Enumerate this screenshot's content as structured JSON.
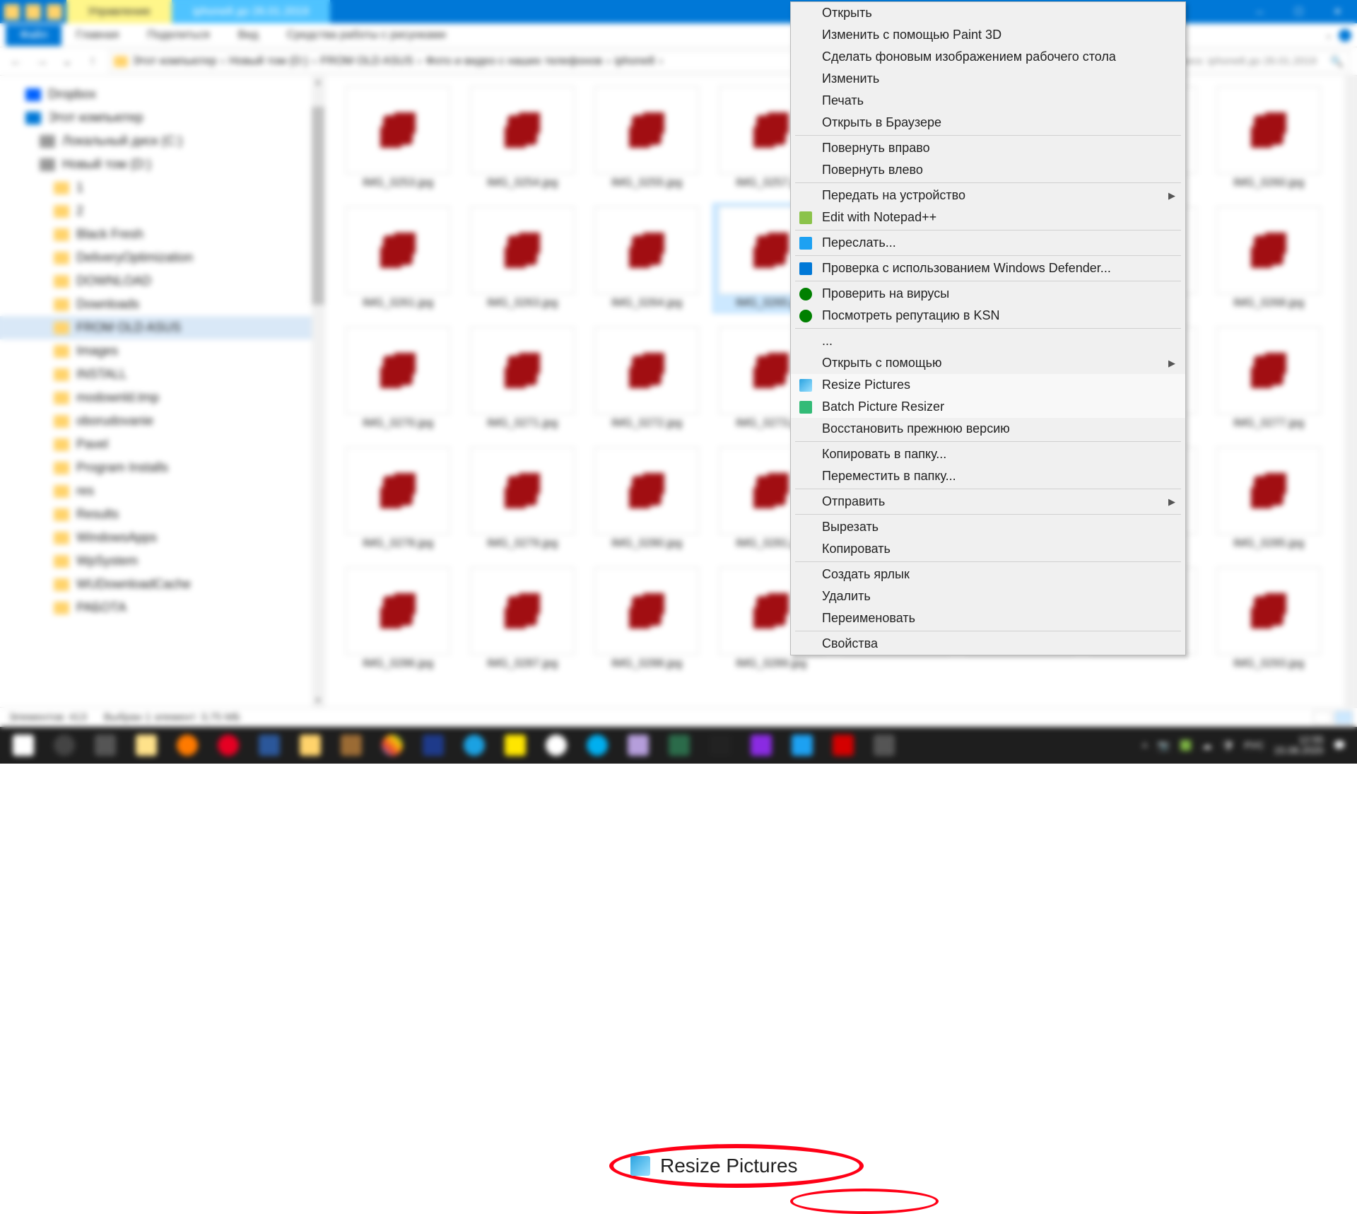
{
  "title_bar": {
    "tab_manage": "Управление",
    "tab_folder": "iphone8 до 26.01.2019"
  },
  "ribbon": {
    "file": "Файл",
    "home": "Главная",
    "share": "Поделиться",
    "view": "Вид",
    "pic_tools": "Средства работы с рисунками"
  },
  "breadcrumb": {
    "b1": "Этот компьютер",
    "b2": "Новый том (D:)",
    "b3": "FROM OLD ASUS",
    "b4": "Фото и видео с наших телефонов",
    "b5": "iphone8",
    "search_placeholder": "Поиск: iphone8 до 26.01.2019"
  },
  "sidebar": {
    "items": [
      {
        "label": "Dropbox",
        "icon": "dropbox",
        "indent": 0
      },
      {
        "label": "Этот компьютер",
        "icon": "pc",
        "indent": 0
      },
      {
        "label": "Локальный диск (C:)",
        "icon": "drive",
        "indent": 1
      },
      {
        "label": "Новый том (D:)",
        "icon": "drive",
        "indent": 1
      },
      {
        "label": "1",
        "icon": "",
        "indent": 2
      },
      {
        "label": "2",
        "icon": "",
        "indent": 2
      },
      {
        "label": "Black Fresh",
        "icon": "",
        "indent": 2
      },
      {
        "label": "DeliveryOptimization",
        "icon": "",
        "indent": 2
      },
      {
        "label": "DOWNLOAD",
        "icon": "",
        "indent": 2
      },
      {
        "label": "Downloads",
        "icon": "",
        "indent": 2
      },
      {
        "label": "FROM OLD ASUS",
        "icon": "",
        "indent": 2,
        "selected": true
      },
      {
        "label": "Images",
        "icon": "",
        "indent": 2
      },
      {
        "label": "INSTALL",
        "icon": "",
        "indent": 2
      },
      {
        "label": "modownld.tmp",
        "icon": "",
        "indent": 2
      },
      {
        "label": "oborudovanie",
        "icon": "",
        "indent": 2
      },
      {
        "label": "Pavel",
        "icon": "",
        "indent": 2
      },
      {
        "label": "Program Installs",
        "icon": "",
        "indent": 2
      },
      {
        "label": "res",
        "icon": "",
        "indent": 2
      },
      {
        "label": "Results",
        "icon": "",
        "indent": 2
      },
      {
        "label": "WindowsApps",
        "icon": "",
        "indent": 2
      },
      {
        "label": "WpSystem",
        "icon": "",
        "indent": 2
      },
      {
        "label": "WUDownloadCache",
        "icon": "",
        "indent": 2
      },
      {
        "label": "РАБОТА",
        "icon": "",
        "indent": 2
      }
    ]
  },
  "files": [
    "IMG_0253.jpg",
    "IMG_0254.jpg",
    "IMG_0255.jpg",
    "IMG_0257.jpg",
    "",
    "",
    "",
    "IMG_0260.jpg",
    "IMG_0261.jpg",
    "IMG_0263.jpg",
    "IMG_0264.jpg",
    "IMG_0265.jpg",
    "",
    "",
    "",
    "IMG_0268.jpg",
    "IMG_0270.jpg",
    "IMG_0271.jpg",
    "IMG_0272.jpg",
    "IMG_0273.jpg",
    "",
    "",
    "",
    "IMG_0277.jpg",
    "IMG_0278.jpg",
    "IMG_0279.jpg",
    "IMG_0280.jpg",
    "IMG_0281.jpg",
    "",
    "",
    "",
    "IMG_0285.jpg",
    "IMG_0286.jpg",
    "IMG_0287.jpg",
    "IMG_0288.jpg",
    "IMG_0289.jpg",
    "",
    "",
    "",
    "IMG_0293.jpg"
  ],
  "selected_file_index": 11,
  "context_menu": {
    "open": "Открыть",
    "edit_paint3d": "Изменить с помощью Paint 3D",
    "set_wallpaper": "Сделать фоновым изображением рабочего стола",
    "edit": "Изменить",
    "print": "Печать",
    "open_browser": "Открыть в Браузере",
    "rotate_right": "Повернуть вправо",
    "rotate_left": "Повернуть влево",
    "cast_to": "Передать на устройство",
    "edit_notepad": "Edit with Notepad++",
    "send": "Переслать...",
    "scan_defender": "Проверка с использованием Windows Defender...",
    "scan_virus": "Проверить на вирусы",
    "check_rep": "Посмотреть репутацию в KSN",
    "dot_dot": "...",
    "open_with": "Открыть с помощью",
    "resize_pictures": "Resize Pictures",
    "batch_resizer": "Batch Picture Resizer",
    "restore_prev": "Восстановить прежнюю версию",
    "copy_to": "Копировать в папку...",
    "move_to": "Переместить в папку...",
    "send_to": "Отправить",
    "cut": "Вырезать",
    "copy": "Копировать",
    "create_shortcut": "Создать ярлык",
    "delete": "Удалить",
    "rename": "Переименовать",
    "properties": "Свойства"
  },
  "callout_label": "Resize Pictures",
  "status": {
    "count": "Элементов: 413",
    "selection": "Выбран 1 элемент: 3,75 МБ"
  },
  "tray": {
    "lang": "РУС",
    "time": "12:55",
    "date": "15.08.2020"
  }
}
